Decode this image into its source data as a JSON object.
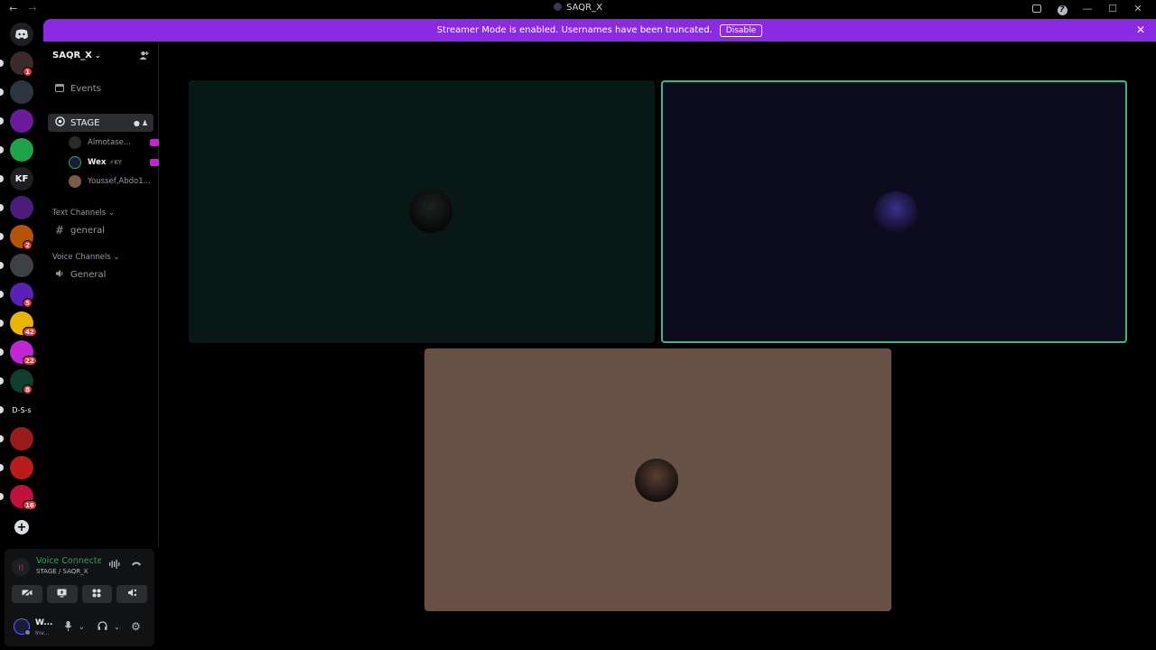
{
  "window": {
    "title": "SAQR_X",
    "back": "←",
    "forward": "→",
    "help": "?",
    "minimize": "—",
    "maximize": "☐",
    "close": "✕"
  },
  "banner": {
    "text": "Streamer Mode is enabled. Usernames have been truncated.",
    "button": "Disable",
    "close": "✕"
  },
  "rail": {
    "servers": [
      {
        "label": "",
        "color": "#3a2a2a",
        "badge": "1"
      },
      {
        "label": "",
        "color": "#2c3540",
        "badge": ""
      },
      {
        "label": "",
        "color": "#6a1b9a",
        "badge": ""
      },
      {
        "label": "",
        "color": "#1fa34a",
        "badge": ""
      },
      {
        "label": "KF",
        "color": "#1e1f22",
        "badge": ""
      },
      {
        "label": "",
        "color": "#4b1d7a",
        "badge": ""
      },
      {
        "label": "",
        "color": "#b45309",
        "badge": "2"
      },
      {
        "label": "",
        "color": "#3f3f46",
        "badge": ""
      },
      {
        "label": "",
        "color": "#5b21b6",
        "badge": "5"
      },
      {
        "label": "",
        "color": "#eab308",
        "badge": "42"
      },
      {
        "label": "",
        "color": "#c026d3",
        "badge": "22"
      },
      {
        "label": "",
        "color": "#0f3d2e",
        "badge": "8"
      },
      {
        "label": "D-S-s",
        "color": "#000000",
        "badge": ""
      },
      {
        "label": "",
        "color": "#991b1b",
        "badge": ""
      },
      {
        "label": "",
        "color": "#b91c1c",
        "badge": ""
      },
      {
        "label": "",
        "color": "#be123c",
        "badge": "16"
      }
    ],
    "add": "+"
  },
  "sidebar": {
    "server_name": "SAQR_X",
    "events": "Events",
    "stage_channel": "STAGE",
    "members": [
      {
        "name": "Almotase...",
        "avatar": "#2a2a2a"
      },
      {
        "name": "Wex",
        "extra": "⚡KY",
        "avatar": "#1a1a3a"
      },
      {
        "name": "Youssef,Abdo1...",
        "avatar": "#7a5a4a"
      }
    ],
    "text_category": "Text Channels",
    "text_channel": "general",
    "voice_category": "Voice Channels",
    "voice_channel": "General"
  },
  "voice_panel": {
    "status": "Voice Connected",
    "location": "STAGE / SAQR_X",
    "username": "W...",
    "user_status": "Inv..."
  },
  "stage": {
    "tiles": [
      {
        "bg": "#071816",
        "avatar": "#1c2220",
        "speaking": false
      },
      {
        "bg": "#0d0b1e",
        "avatar": "#3b2f8a",
        "speaking": true
      },
      {
        "bg": "#675146",
        "avatar": "#5a3e33",
        "speaking": false
      }
    ]
  },
  "colors": {
    "accent_banner": "#8a2be2",
    "speaking_ring": "#43b581",
    "voice_connected": "#23a55a",
    "badge": "#da373c"
  }
}
